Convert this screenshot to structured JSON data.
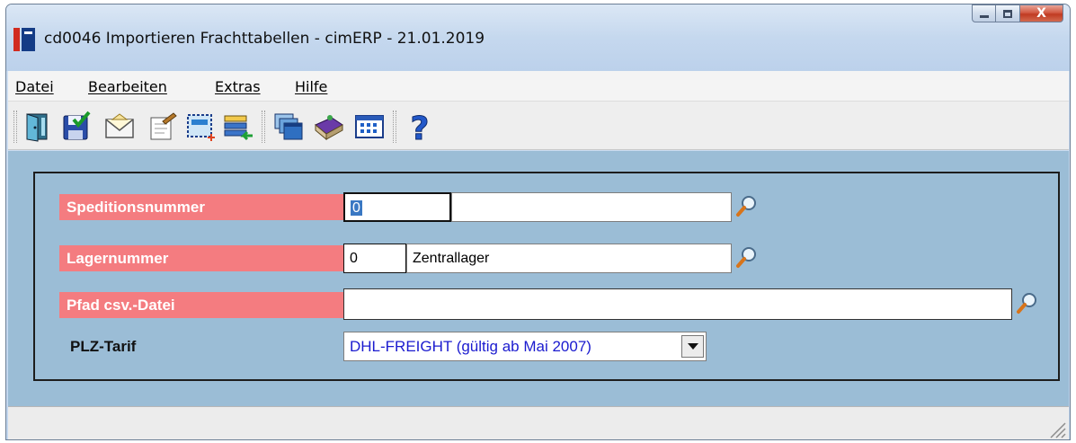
{
  "window": {
    "title": "cd0046 Importieren Frachttabellen - cimERP - 21.01.2019",
    "controls": {
      "minimize": "minimize-icon",
      "maximize": "maximize-icon",
      "close": "X"
    }
  },
  "menu": [
    {
      "label": "Datei"
    },
    {
      "label": "Bearbeiten"
    },
    {
      "label": "Extras"
    },
    {
      "label": "Hilfe"
    }
  ],
  "toolbar": {
    "icons": [
      "exit-door-icon",
      "save-icon",
      "mail-envelope-icon",
      "edit-note-icon",
      "new-selection-icon",
      "list-transfer-icon",
      "windows-cascade-icon",
      "book-icon",
      "table-grid-icon",
      "help-question-icon"
    ]
  },
  "form": {
    "speditionsnummer": {
      "label": "Speditionsnummer",
      "value": "0",
      "name": ""
    },
    "lagernummer": {
      "label": "Lagernummer",
      "value": "0",
      "name": "Zentrallager"
    },
    "pfad": {
      "label": "Pfad csv.-Datei",
      "value": ""
    },
    "plz_tarif": {
      "label": "PLZ-Tarif",
      "selected": "DHL-FREIGHT (gültig ab Mai 2007)"
    }
  },
  "colors": {
    "required_label": "#f47c80",
    "client_bg": "#9bbdd6",
    "combo_text": "#1b1bcf"
  },
  "statusbar": {
    "text": ""
  }
}
